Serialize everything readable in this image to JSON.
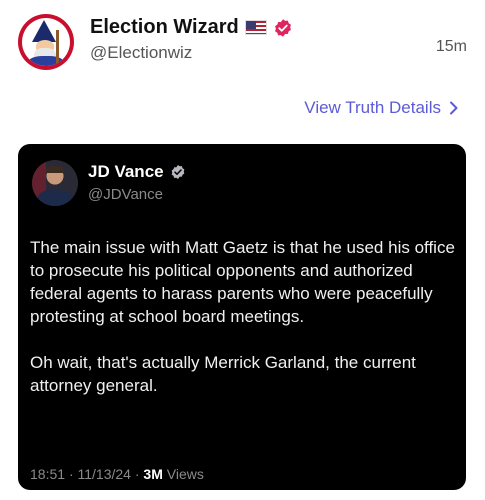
{
  "post": {
    "author_name": "Election Wizard",
    "author_handle": "@Electionwiz",
    "timestamp": "15m",
    "flag_icon": "us-flag-icon",
    "verified_icon": "verified-badge-icon",
    "verified_color": "#e0245e"
  },
  "view_details": {
    "label": "View Truth Details",
    "icon": "chevron-right-icon",
    "color": "#5b5bd6"
  },
  "embedded_post": {
    "author_name": "JD Vance",
    "author_handle": "@JDVance",
    "paragraphs": [
      "The main issue with Matt Gaetz is that he used his office to prosecute his political opponents and authorized federal agents to harass parents who were peacefully protesting at school board meetings.",
      "Oh wait, that's actually Merrick Garland, the current attorney general."
    ],
    "time": "18:51",
    "date": "11/13/24",
    "views_count": "3M",
    "views_label": "Views"
  }
}
